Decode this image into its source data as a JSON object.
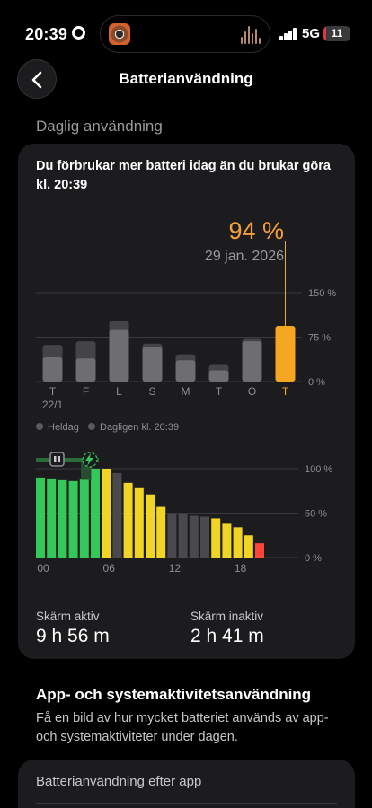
{
  "status_bar": {
    "time": "20:39",
    "network": "5G",
    "battery_level": "11",
    "battery_fraction": 0.11,
    "icons": [
      "gear-icon",
      "app-thumbnail-icon",
      "audio-waveform-icon",
      "cellular-signal-icon",
      "battery-icon"
    ]
  },
  "header": {
    "title": "Batterianvändning",
    "back_icon": "chevron-left-icon"
  },
  "daily": {
    "section_label": "Daglig användning",
    "summary": "Du förbrukar mer batteri idag än du brukar göra kl. 20:39",
    "callout_value": "94 %",
    "callout_date": "29 jan. 2026"
  },
  "chart_data": [
    {
      "type": "bar",
      "subtype": "stacked-overlay",
      "categories": [
        "T",
        "F",
        "L",
        "S",
        "M",
        "T",
        "O",
        "T"
      ],
      "first_category_sublabel": "22/1",
      "y_ticks": [
        "150 %",
        "75 %",
        "0 %"
      ],
      "ylim": [
        0,
        150
      ],
      "series": [
        {
          "name": "Heldag",
          "values": [
            62,
            68,
            103,
            64,
            46,
            28,
            72,
            null
          ]
        },
        {
          "name": "Dagligen kl. 20:39",
          "values": [
            41,
            39,
            87,
            58,
            36,
            19,
            68,
            94
          ]
        }
      ],
      "highlight": {
        "index": 7,
        "value": 94,
        "color": "#f5a623"
      },
      "grid": true,
      "legend": "bottom-left"
    },
    {
      "type": "bar",
      "subtype": "battery-level-by-hour",
      "x_ticks": [
        "00",
        "06",
        "12",
        "18"
      ],
      "y_ticks": [
        "100 %",
        "50 %",
        "0 %"
      ],
      "ylim": [
        0,
        100
      ],
      "x": [
        0,
        1,
        2,
        3,
        4,
        5,
        6,
        7,
        8,
        9,
        10,
        11,
        12,
        13,
        14,
        15,
        16,
        17,
        18,
        19,
        20
      ],
      "values": [
        90,
        89,
        87,
        86,
        88,
        100,
        100,
        95,
        84,
        78,
        71,
        57,
        49,
        49,
        47,
        46,
        44,
        38,
        34,
        25,
        16
      ],
      "levels": [
        "green",
        "green",
        "green",
        "green",
        "green",
        "green",
        "yellow",
        "gray",
        "yellow",
        "yellow",
        "yellow",
        "yellow",
        "gray",
        "gray",
        "gray",
        "gray",
        "yellow",
        "yellow",
        "yellow",
        "yellow",
        "red"
      ],
      "colors": {
        "green": "#34c759",
        "yellow": "#f0d524",
        "gray": "#4a4a4e",
        "red": "#ff453a"
      },
      "markers": [
        "pause-icon",
        "charging-bolt-icon"
      ],
      "grid": true
    }
  ],
  "screen": {
    "active_label": "Skärm aktiv",
    "active_value": "9 h 56 m",
    "inactive_label": "Skärm inaktiv",
    "inactive_value": "2 h 41 m"
  },
  "app_activity": {
    "title": "App- och systemaktivitetsanvändning",
    "description": "Få en bild av hur mycket batteriet används av app- och systemaktiviteter under dagen."
  },
  "by_app": {
    "title": "Batterianvändning efter app"
  }
}
